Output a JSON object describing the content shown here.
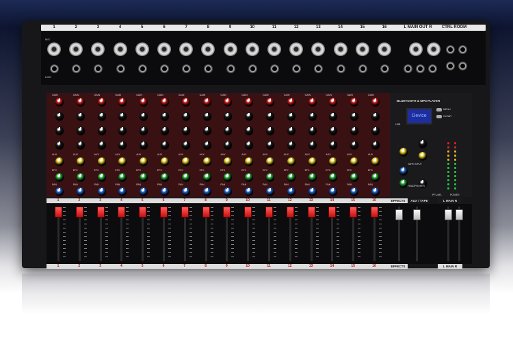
{
  "channels": [
    "1",
    "2",
    "3",
    "4",
    "5",
    "6",
    "7",
    "8",
    "9",
    "10",
    "11",
    "12",
    "13",
    "14",
    "15",
    "16"
  ],
  "io_panel": {
    "main_out_label": "L MAIN OUT R",
    "ctrl_room_label": "CTRL ROOM",
    "mic_label": "MIC",
    "line_label": "LINE"
  },
  "player": {
    "title": "BLUETOOTH & MP3 PLAYER",
    "display_text": "Device",
    "buttons": [
      "MENU",
      "CLEAR",
      "USB"
    ]
  },
  "sections": {
    "effects": "EFFECTS",
    "aux_tape": "AUX / TAPE",
    "main": "L MAIN R",
    "power": "POWER",
    "pfl": "PFL/AFL",
    "tape_input": "TAPE INPUT",
    "headphones": "HEADPHONES"
  },
  "knob_labels": [
    "GAIN",
    "HI",
    "MID",
    "LO",
    "AUX",
    "EFX",
    "PAN"
  ],
  "colors": {
    "gain": "#c81a1a",
    "eq": "#1a1a1a",
    "aux": "#e0c81e",
    "efx": "#23a83a",
    "pan": "#2060c8"
  }
}
